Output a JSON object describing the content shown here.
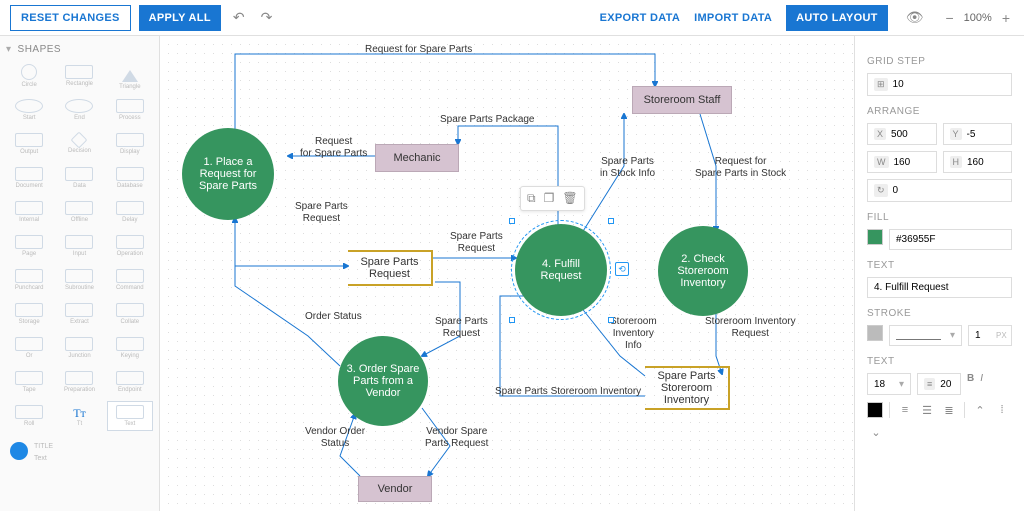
{
  "toolbar": {
    "reset": "RESET CHANGES",
    "apply": "APPLY ALL",
    "export": "EXPORT DATA",
    "import": "IMPORT DATA",
    "auto": "AUTO LAYOUT",
    "zoom": "100%"
  },
  "shapes": {
    "title": "SHAPES",
    "items": [
      "Circle",
      "Rectangle",
      "Triangle",
      "Start",
      "End",
      "Process",
      "Output",
      "Decision",
      "Display",
      "Document",
      "Data",
      "Database",
      "Internal",
      "Offline",
      "Delay",
      "Page",
      "Input",
      "Operation",
      "Punchcard",
      "Subroutine",
      "Command",
      "Storage",
      "Extract",
      "Collate",
      "Or",
      "Junction",
      "Keying",
      "Tape",
      "Preparation",
      "Endpoint",
      "Roll",
      "Tt",
      "Text"
    ],
    "selTitle": "TITLE",
    "selSub": "Text"
  },
  "nodes": {
    "storeroomStaff": "Storeroom Staff",
    "mechanic": "Mechanic",
    "vendor": "Vendor",
    "placeRequest": "1. Place a Request for Spare Parts",
    "checkInventory": "2. Check Storeroom Inventory",
    "orderVendor": "3. Order Spare Parts from a Vendor",
    "fulfill": "4. Fulfill Request",
    "sparePartsRequest": "Spare Parts Request",
    "sparePartsInventory": "Spare Parts Storeroom Inventory"
  },
  "edges": {
    "requestForSpare": "Request for Spare Parts",
    "sparePartsPackage": "Spare Parts Package",
    "requestForSpareS": "Request\nfor Spare Parts",
    "sparePartsInStock": "Spare Parts\nin Stock Info",
    "requestForStock": "Request for\nSpare Parts in Stock",
    "sparePartsReq1": "Spare Parts\nRequest",
    "sparePartsReq2": "Spare Parts\nRequest",
    "sparePartsReq3": "Spare Parts\nRequest",
    "orderStatus": "Order Status",
    "storeroomInvInfo": "Storeroom\nInventory\nInfo",
    "storeroomInvReq": "Storeroom Inventory\nRequest",
    "sparePartsStoreInv": "Spare Parts Storeroom Inventory",
    "vendorOrderStatus": "Vendor Order\nStatus",
    "vendorSpareReq": "Vendor Spare\nParts Request"
  },
  "props": {
    "gridStepLabel": "GRID STEP",
    "gridStep": "10",
    "arrangeLabel": "ARRANGE",
    "x": "500",
    "y": "-5",
    "w": "160",
    "h": "160",
    "angle": "0",
    "fillLabel": "FILL",
    "fill": "#36955F",
    "textLabel": "TEXT",
    "text": "4. Fulfill Request",
    "strokeLabel": "STROKE",
    "strokeWidth": "1",
    "strokeUnit": "PX",
    "text2Label": "TEXT",
    "fontSize": "18",
    "lineHeight": "20"
  },
  "chart_data": {
    "type": "flowchart",
    "nodes": [
      {
        "id": "storeroomStaff",
        "label": "Storeroom Staff",
        "shape": "rect"
      },
      {
        "id": "mechanic",
        "label": "Mechanic",
        "shape": "rect"
      },
      {
        "id": "vendor",
        "label": "Vendor",
        "shape": "rect"
      },
      {
        "id": "n1",
        "label": "1. Place a Request for Spare Parts",
        "shape": "circle"
      },
      {
        "id": "n2",
        "label": "2. Check Storeroom Inventory",
        "shape": "circle"
      },
      {
        "id": "n3",
        "label": "3. Order Spare Parts from a Vendor",
        "shape": "circle"
      },
      {
        "id": "n4",
        "label": "4. Fulfill Request",
        "shape": "circle",
        "selected": true
      },
      {
        "id": "spr",
        "label": "Spare Parts Request",
        "shape": "frame"
      },
      {
        "id": "spi",
        "label": "Spare Parts Storeroom Inventory",
        "shape": "frame"
      }
    ],
    "edges": [
      {
        "from": "n1",
        "to": "storeroomStaff",
        "label": "Request for Spare Parts"
      },
      {
        "from": "mechanic",
        "to": "n1",
        "label": "Request for Spare Parts"
      },
      {
        "from": "n4",
        "to": "mechanic",
        "label": "Spare Parts Package"
      },
      {
        "from": "n4",
        "to": "storeroomStaff",
        "label": "Spare Parts in Stock Info"
      },
      {
        "from": "storeroomStaff",
        "to": "n2",
        "label": "Request for Spare Parts in Stock"
      },
      {
        "from": "n1",
        "to": "spr",
        "label": "Spare Parts Request"
      },
      {
        "from": "spr",
        "to": "n4",
        "label": "Spare Parts Request"
      },
      {
        "from": "spr",
        "to": "n3",
        "label": "Spare Parts Request"
      },
      {
        "from": "n3",
        "to": "n1",
        "label": "Order Status"
      },
      {
        "from": "spi",
        "to": "n4",
        "label": "Storeroom Inventory Info"
      },
      {
        "from": "n2",
        "to": "spi",
        "label": "Storeroom Inventory Request"
      },
      {
        "from": "spi",
        "to": "n2",
        "label": "Spare Parts Storeroom Inventory"
      },
      {
        "from": "vendor",
        "to": "n3",
        "label": "Vendor Order Status"
      },
      {
        "from": "n3",
        "to": "vendor",
        "label": "Vendor Spare Parts Request"
      }
    ]
  }
}
